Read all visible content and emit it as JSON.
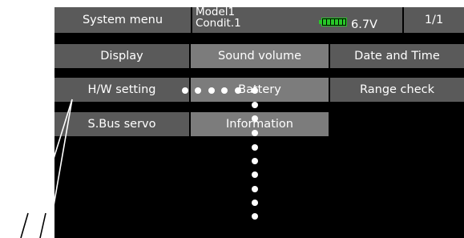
{
  "header": {
    "menu_title": "System menu",
    "model_name": "Model1",
    "condition": "Condit.1",
    "voltage": "6.7V",
    "page_indicator": "1/1"
  },
  "buttons": [
    {
      "label": "Display"
    },
    {
      "label": "Sound volume"
    },
    {
      "label": "Date and Time"
    },
    {
      "label": "H/W setting"
    },
    {
      "label": "Battery"
    },
    {
      "label": "Range check"
    },
    {
      "label": "S.Bus servo"
    },
    {
      "label": "Information"
    }
  ],
  "battery_level": 1.0
}
